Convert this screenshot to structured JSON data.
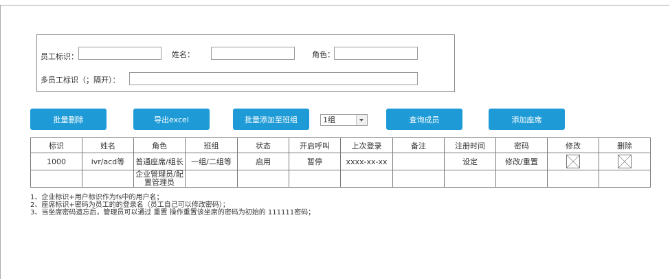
{
  "filters": {
    "employee_id_label": "员工标识：",
    "name_label": "姓名：",
    "role_label": "角色：",
    "multi_id_label": "多员工标识（；隔开）：",
    "employee_id_value": "",
    "name_value": "",
    "role_value": "",
    "multi_id_value": ""
  },
  "toolbar": {
    "batch_delete": "批量删除",
    "export_excel": "导出excel",
    "batch_add_group": "批量添加至班组",
    "group_select_value": "1组",
    "query_members": "查询成员",
    "add_seat": "添加座席"
  },
  "table": {
    "headers": [
      "标识",
      "姓名",
      "角色",
      "班组",
      "状态",
      "开启呼叫",
      "上次登录",
      "备注",
      "注册时间",
      "密码",
      "修改",
      "删除"
    ],
    "row1": {
      "id": "1000",
      "name": "ivr/acd等",
      "role": "普通座席/组长",
      "group": "一组/二组等",
      "status": "启用",
      "call": "暂停",
      "last_login": "xxxx-xx-xx",
      "note": "",
      "reg_time": "设定",
      "password": "修改/重置"
    },
    "row2": {
      "role": "企业管理员/配置管理员"
    }
  },
  "notes": [
    "1、企业标识+用户标识作为fs中的用户名；",
    "2、座席标识+密码为员工的的登录名（员工自己可以修改密码）；",
    "3、当坐席密码遗忘后，管理员可以通过 重置 操作重置该坐席的密码为初始的 111111密码；"
  ],
  "colors": {
    "button_bg": "#1e9bd6",
    "button_text": "#ffffff",
    "border": "#7a7a7a"
  }
}
